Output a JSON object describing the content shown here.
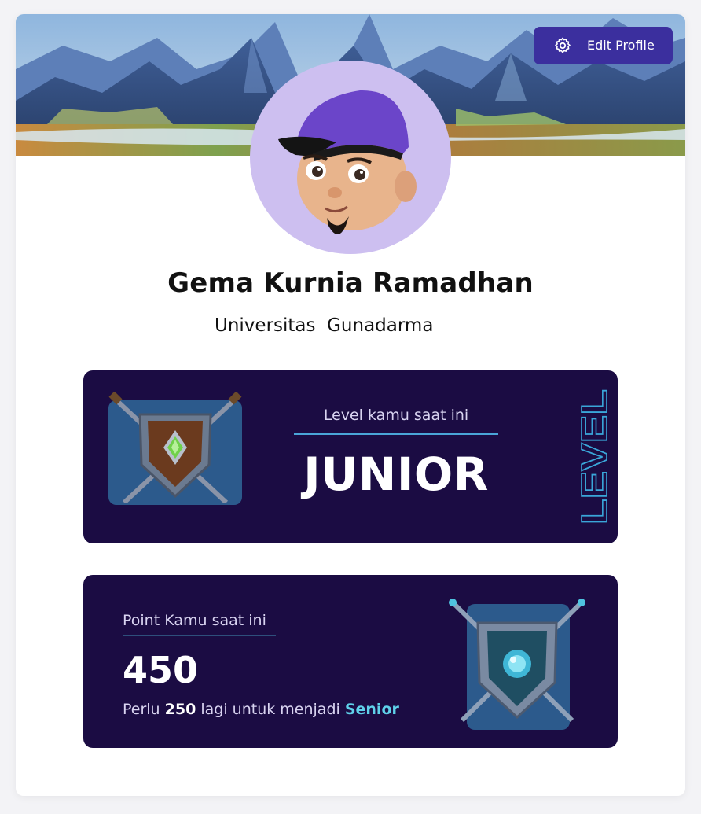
{
  "header": {
    "edit_profile_label": "Edit Profile",
    "edit_icon": "gear-icon",
    "banner_image": "mountain-landscape-banner"
  },
  "profile": {
    "avatar": "memoji-avatar-purple-cap",
    "name": "Gema Kurnia Ramadhan",
    "university": "Universitas  Gunadarma"
  },
  "level_card": {
    "caption": "Level kamu saat ini",
    "value": "JUNIOR",
    "vertical_label": "LEVEL",
    "badge_icon": "shield-swords-green-gem-icon"
  },
  "point_card": {
    "caption": "Point Kamu saat ini",
    "value": "450",
    "note_prefix": "Perlu ",
    "note_amount": "250",
    "note_middle": " lagi untuk menjadi ",
    "note_target": "Senior",
    "badge_icon": "shield-swords-blue-orb-icon"
  },
  "colors": {
    "panel_bg": "#1b0c43",
    "button_bg": "#3b2f9e",
    "avatar_bg": "#cdbff0",
    "accent": "#5fd1ea",
    "badge_bg": "#2c5a8c"
  }
}
